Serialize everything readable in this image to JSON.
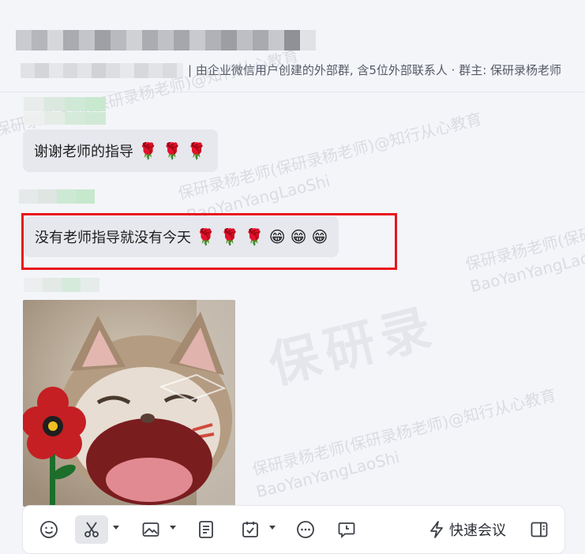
{
  "header": {
    "subtitle": "| 由企业微信用户创建的外部群, 含5位外部联系人 · 群主: 保研录杨老师"
  },
  "watermark": {
    "text_cn": "保研录杨老师(保研录杨老师)@知行从心教育",
    "text_en": "BaoYanYangLaoShi",
    "logo": "保研录"
  },
  "messages": [
    {
      "text": "谢谢老师的指导",
      "emojis": [
        "🌹",
        "🌹",
        "🌹"
      ]
    },
    {
      "text": "没有老师指导就没有今天",
      "emojis": [
        "🌹",
        "🌹",
        "🌹",
        "😁",
        "😁",
        "😁"
      ]
    }
  ],
  "toolbar": {
    "items": [
      {
        "icon": "emoji-icon"
      },
      {
        "icon": "scissors-icon"
      },
      {
        "icon": "image-icon"
      },
      {
        "icon": "document-icon"
      },
      {
        "icon": "task-icon"
      },
      {
        "icon": "more-icon"
      },
      {
        "icon": "message-clock-icon"
      }
    ],
    "meeting_label": "快速会议",
    "panel_icon": "sidebar-panel-icon"
  },
  "colors": {
    "background": "#f4f5f9",
    "bubble": "#e6e8ee",
    "highlight": "#e8141c",
    "text": "#1e1e1e"
  }
}
